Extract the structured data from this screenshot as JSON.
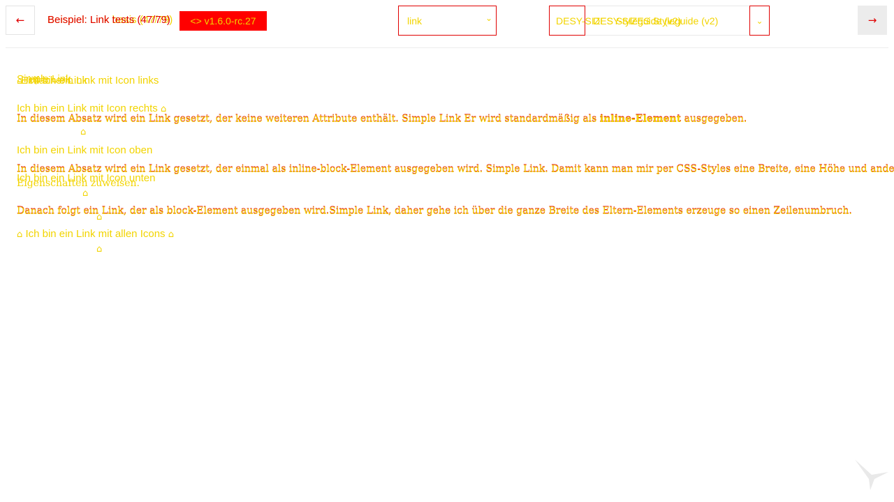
{
  "header": {
    "prev_icon": "arrow-left-icon",
    "next_icon": "arrow-right-icon",
    "title_a": "Beispiel: Link basis (47/79)",
    "title_b": "Beispiel: Link tests (47/79)",
    "version_badge": "<> v1.6.0-rc.27",
    "component_select": {
      "value": "link"
    },
    "theme_select_a": {
      "value": "DESY-SIZES Styleguide (v2)"
    },
    "theme_select_b": {
      "value": "DESY-SIZES Styleguide (v2)"
    }
  },
  "content": {
    "heading_a": "Simple Link",
    "heading_b": "Einfacher Link",
    "link_icon_left": "Ich bin ein Link mit Icon links",
    "link_icon_right": "Ich bin ein Link mit Icon rechts",
    "para1_text": "In diesem Absatz wird ein Link gesetzt, der keine weiteren Attribute enthält. Simple Link Er wird standardmäßig als",
    "para1_bold": "inline-Element",
    "para1_end": "ausgegeben.",
    "link_icon_top": "Ich bin ein Link mit Icon oben",
    "para2_line1": "In diesem Absatz wird ein Link gesetzt, der einmal als inline-block-Element ausgegeben wird. Simple Link. Damit kann man mir per CSS-Styles eine Breite, eine Höhe und andere",
    "para2_line2": "Eigenschaften zuweisen.",
    "link_icon_bottom": "Ich bin ein Link mit Icon unten",
    "para3_text": "Danach folgt ein Link, der als block-Element ausgegeben wird.Simple Link, daher gehe ich über die ganze Breite des Eltern-Elements erzeuge so einen Zeilenumbruch.",
    "link_all_icons": "Ich bin ein Link mit allen Icons",
    "home_glyph": "⌂"
  },
  "colors": {
    "accent_red": "#e00000",
    "overlay_yellow": "#f2d400",
    "badge_red": "#ff0000"
  }
}
